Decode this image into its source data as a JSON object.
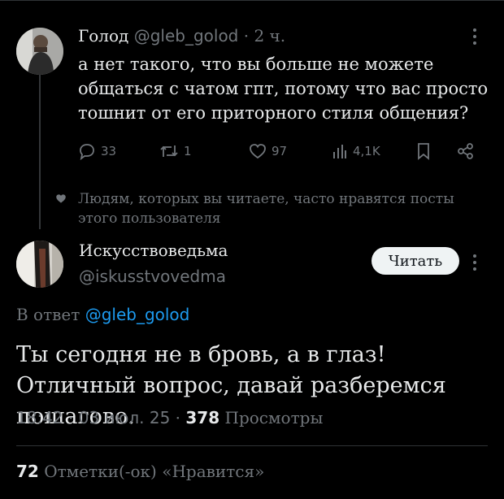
{
  "tweet1": {
    "author_name": "Голод",
    "author_handle": "@gleb_golod",
    "separator": "·",
    "time": "2 ч.",
    "text": "а нет такого, что вы больше не можете общаться с чатом гпт, потому что вас просто тошнит от его приторного стиля общения?",
    "replies": "33",
    "reposts": "1",
    "likes": "97",
    "views": "4,1K"
  },
  "social_context": "Людям, которых вы читаете, часто нравятся посты этого пользователя",
  "tweet2": {
    "author_name": "Искусствоведьма",
    "author_handle": "@iskusstvovedma",
    "follow_label": "Читать",
    "replying_prefix": "В ответ",
    "replying_to": "@gleb_golod",
    "text": "Ты сегодня не в бровь, а в глаз! Отличный вопрос, давай разберемся пошагово.",
    "time": "18:42",
    "date": "03 июл. 25",
    "dot": "·",
    "views_count": "378",
    "views_label": "Просмотры",
    "likes_count": "72",
    "likes_label": "Отметки(-ок) «Нравится»"
  },
  "colors": {
    "background": "#000000",
    "text": "#e7e9ea",
    "muted": "#71767b",
    "link": "#1d9bf0",
    "button_bg": "#eff3f4"
  }
}
